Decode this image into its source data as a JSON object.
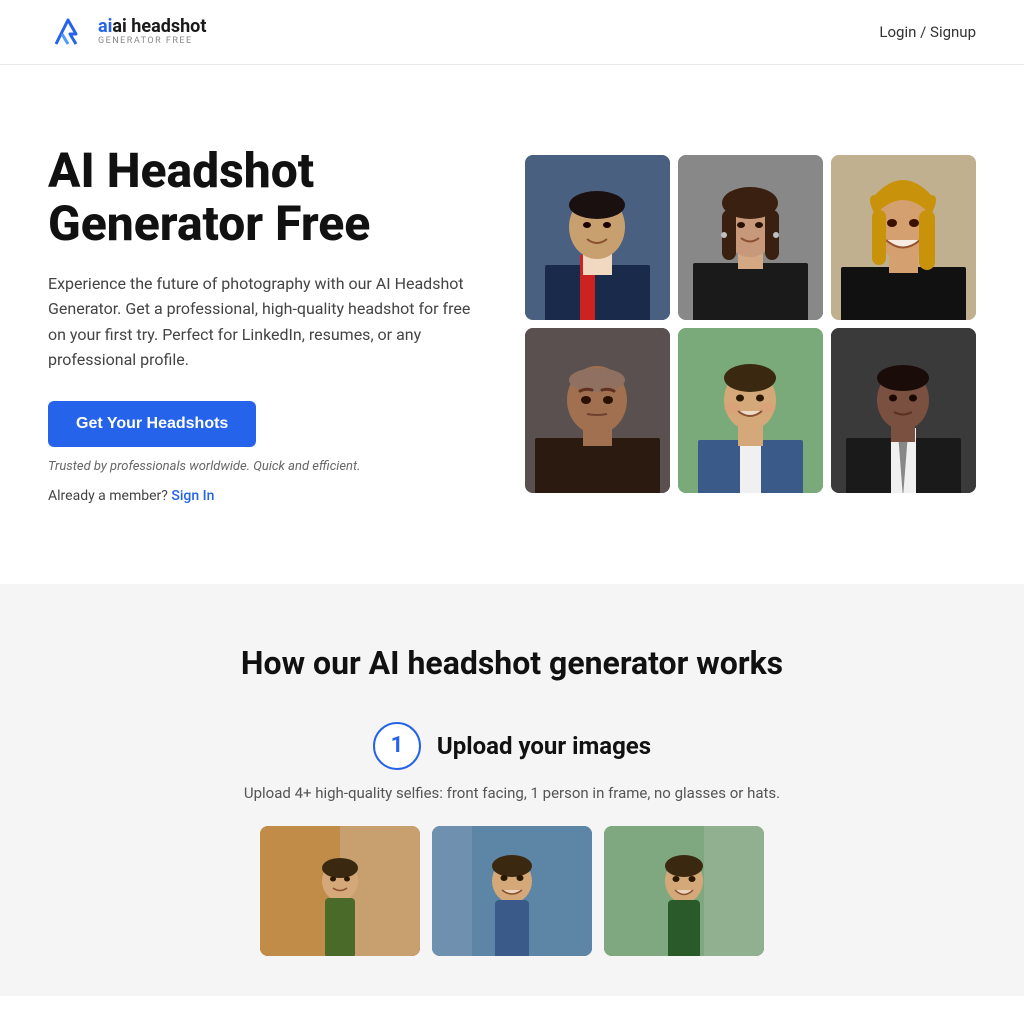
{
  "header": {
    "logo_main_text": "ai headshot",
    "logo_accent": "ai",
    "logo_sub": "GENERATOR FREE",
    "nav_login": "Login / Signup"
  },
  "hero": {
    "title": "AI Headshot Generator Free",
    "description": "Experience the future of photography with our AI Headshot Generator. Get a professional, high-quality headshot for free on your first try. Perfect for LinkedIn, resumes, or any professional profile.",
    "cta_label": "Get Your Headshots",
    "trusted_text": "Trusted by professionals worldwide. Quick and efficient.",
    "already_member_text": "Already a member?",
    "sign_in_label": "Sign In"
  },
  "headshots": [
    {
      "id": 1,
      "alt": "Man in suit smiling"
    },
    {
      "id": 2,
      "alt": "Woman professional headshot"
    },
    {
      "id": 3,
      "alt": "Woman smiling headshot"
    },
    {
      "id": 4,
      "alt": "Bald man serious headshot"
    },
    {
      "id": 5,
      "alt": "Young man smiling outdoors"
    },
    {
      "id": 6,
      "alt": "Black man in suit headshot"
    }
  ],
  "how_section": {
    "title": "How our AI headshot generator works",
    "step1": {
      "number": "1",
      "label": "Upload your images",
      "description": "Upload 4+ high-quality selfies: front facing, 1 person in frame, no glasses or hats."
    }
  },
  "sample_photos": [
    {
      "alt": "Sample selfie 1"
    },
    {
      "alt": "Sample selfie 2"
    },
    {
      "alt": "Sample selfie 3"
    }
  ]
}
